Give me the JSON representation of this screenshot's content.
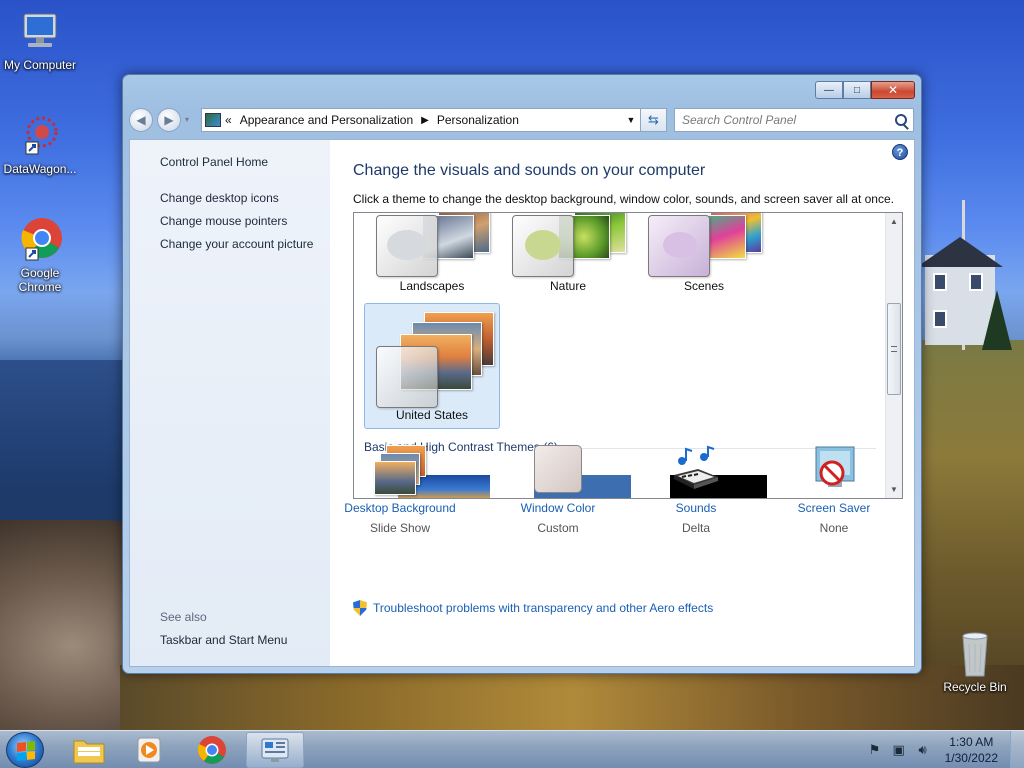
{
  "desktop": {
    "icons": [
      {
        "label": "My Computer"
      },
      {
        "label": "DataWagon..."
      },
      {
        "label": "Google Chrome"
      },
      {
        "label": "Recycle Bin"
      }
    ]
  },
  "window": {
    "caption_buttons": {
      "minimize": "—",
      "maximize": "□",
      "close": "✕"
    },
    "nav": {
      "back": "◀",
      "forward": "▶",
      "breadcrumb_prefix": "«",
      "breadcrumb": [
        "Appearance and Personalization",
        "Personalization"
      ],
      "search_placeholder": "Search Control Panel"
    },
    "sidebar": {
      "home": "Control Panel Home",
      "links": [
        "Change desktop icons",
        "Change mouse pointers",
        "Change your account picture"
      ],
      "see_also_title": "See also",
      "see_also_links": [
        "Taskbar and Start Menu"
      ]
    },
    "main": {
      "help": "?",
      "heading": "Change the visuals and sounds on your computer",
      "description": "Click a theme to change the desktop background, window color, sounds, and screen saver all at once.",
      "themes": [
        {
          "name": "Landscapes"
        },
        {
          "name": "Nature"
        },
        {
          "name": "Scenes"
        },
        {
          "name": "United States",
          "selected": true
        }
      ],
      "basic_group_label": "Basic and High Contrast Themes (6)",
      "bottom_items": [
        {
          "label": "Desktop Background",
          "value": "Slide Show"
        },
        {
          "label": "Window Color",
          "value": "Custom"
        },
        {
          "label": "Sounds",
          "value": "Delta"
        },
        {
          "label": "Screen Saver",
          "value": "None"
        }
      ],
      "troubleshoot": "Troubleshoot problems with transparency and other Aero effects"
    }
  },
  "taskbar": {
    "clock_time": "1:30 AM",
    "clock_date": "1/30/2022"
  },
  "colors": {
    "link": "#1a5fb4",
    "heading": "#1e3a6a",
    "selected_theme_bg": "#dbeaf9"
  }
}
